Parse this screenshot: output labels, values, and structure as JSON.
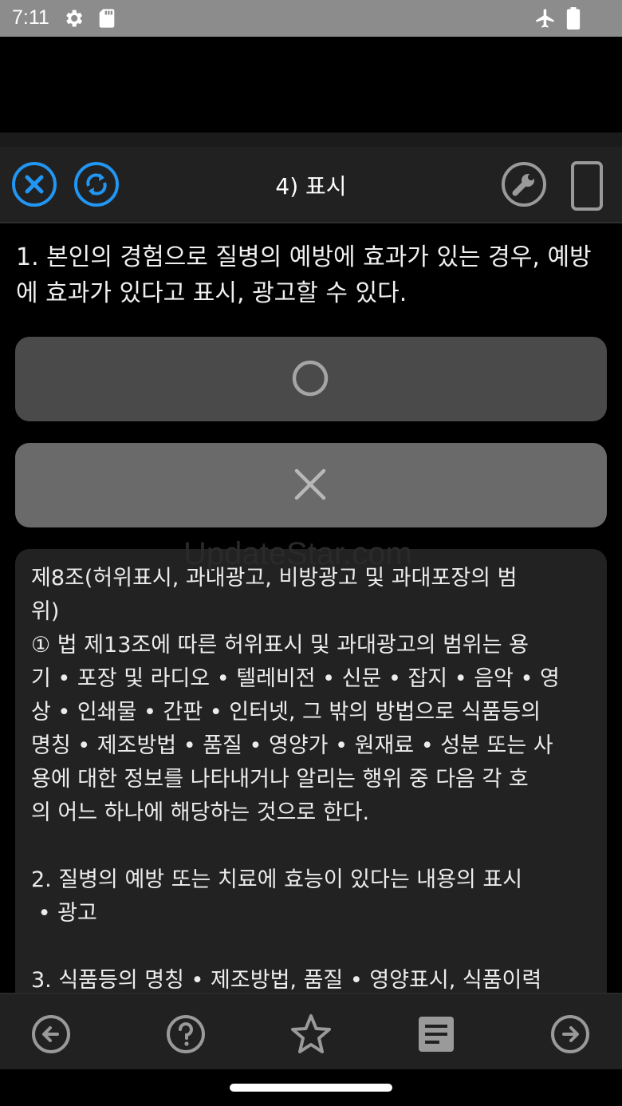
{
  "status_bar": {
    "time": "7:11",
    "icons": [
      "gear-icon",
      "sd-card-icon",
      "airplane-icon",
      "battery-icon"
    ]
  },
  "toolbar": {
    "title": "4) 표시",
    "left_icons": [
      "close-circle-icon",
      "sync-circle-icon"
    ],
    "right_icons": [
      "wrench-icon",
      "phone-icon"
    ],
    "accent_color": "#2196f3"
  },
  "question": {
    "text": "1. 본인의 경험으로 질병의 예방에 효과가 있는 경우, 예방에 효과가 있다고 표시, 광고할 수 있다."
  },
  "answers": [
    {
      "symbol": "O",
      "icon": "circle-icon"
    },
    {
      "symbol": "X",
      "icon": "x-icon"
    }
  ],
  "watermark": "UpdateStar.com",
  "explanation": {
    "text": "제8조(허위표시, 과대광고, 비방광고 및 과대포장의 범\n위)\n① 법 제13조에 따른 허위표시 및 과대광고의 범위는 용\n기 • 포장 및 라디오 • 텔레비전 • 신문 • 잡지 • 음악 • 영\n상 • 인쇄물 • 간판 • 인터넷, 그 밖의 방법으로 식품등의\n명칭 • 제조방법 • 품질 • 영양가 • 원재료 • 성분 또는 사\n용에 대한 정보를 나타내거나 알리는 행위 중 다음 각 호\n의 어느 하나에 해당하는 것으로 한다.\n\n2. 질병의 예방 또는 치료에 효능이 있다는 내용의 표시\n • 광고\n\n3. 식품등의 명칭 • 제조방법, 품질 • 영양표시, 식품이력"
  },
  "bottom_nav": [
    "arrow-left-circle-icon",
    "help-circle-icon",
    "star-icon",
    "note-icon",
    "arrow-right-circle-icon"
  ]
}
